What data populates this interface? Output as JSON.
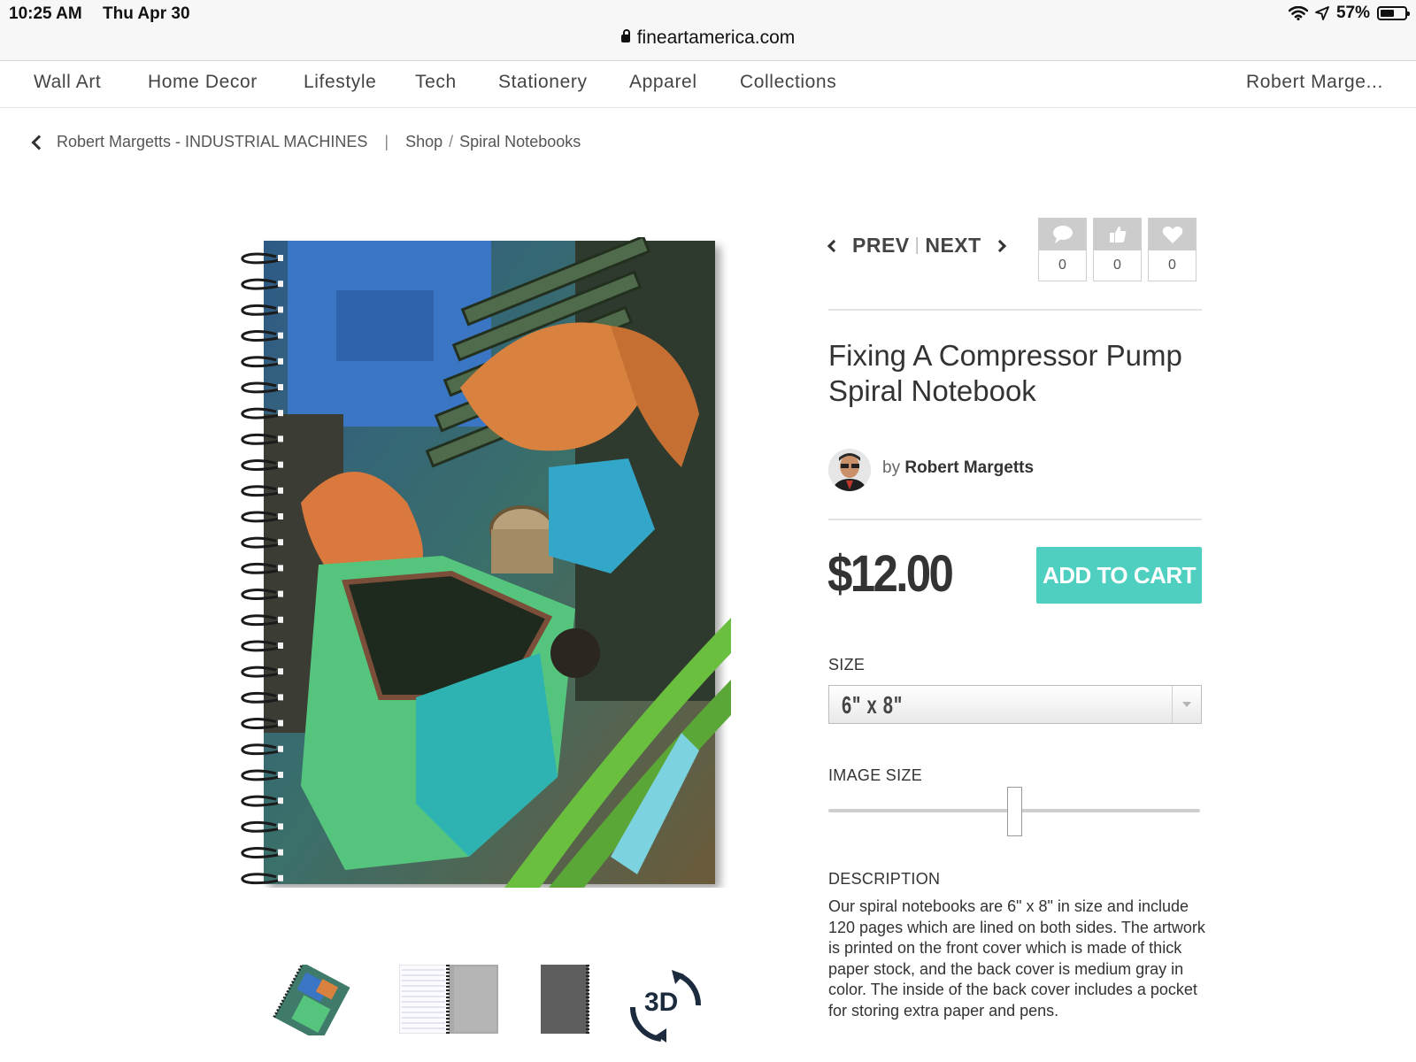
{
  "status_bar": {
    "time": "10:25 AM",
    "date": "Thu Apr 30",
    "url": "fineartamerica.com",
    "battery": "57%",
    "battery_level": 0.57
  },
  "nav": {
    "items": [
      "Wall Art",
      "Home Decor",
      "Lifestyle",
      "Tech",
      "Stationery",
      "Apparel",
      "Collections"
    ],
    "user": "Robert Marge..."
  },
  "breadcrumb": {
    "back": "Robert Margetts - INDUSTRIAL MACHINES",
    "separator": "|",
    "shop": "Shop",
    "slash": "/",
    "category": "Spiral Notebooks"
  },
  "pager": {
    "prev": "PREV",
    "divider": "|",
    "next": "NEXT"
  },
  "social": {
    "comments": "0",
    "likes": "0",
    "favorites": "0"
  },
  "product": {
    "title_line1": "Fixing A Compressor Pump",
    "title_line2": "Spiral Notebook",
    "by": "by",
    "author": "Robert Margetts",
    "price": "$12.00",
    "add_to_cart": "ADD TO CART"
  },
  "options": {
    "size_label": "SIZE",
    "size_value": "6\" x 8\"",
    "image_size_label": "IMAGE SIZE",
    "image_size_level": 0.5
  },
  "description": {
    "label": "DESCRIPTION",
    "text": "Our spiral notebooks are 6\" x 8\" in size and include 120 pages which are lined on both sides. The artwork is printed on the front cover which is made of thick paper stock, and the back cover is medium gray in color. The inside of the back cover includes a pocket for storing extra paper and pens."
  },
  "thumbnails": {
    "view_3d": "3D"
  },
  "colors": {
    "accent": "#4ecfc0",
    "social_box": "#cccccc"
  }
}
